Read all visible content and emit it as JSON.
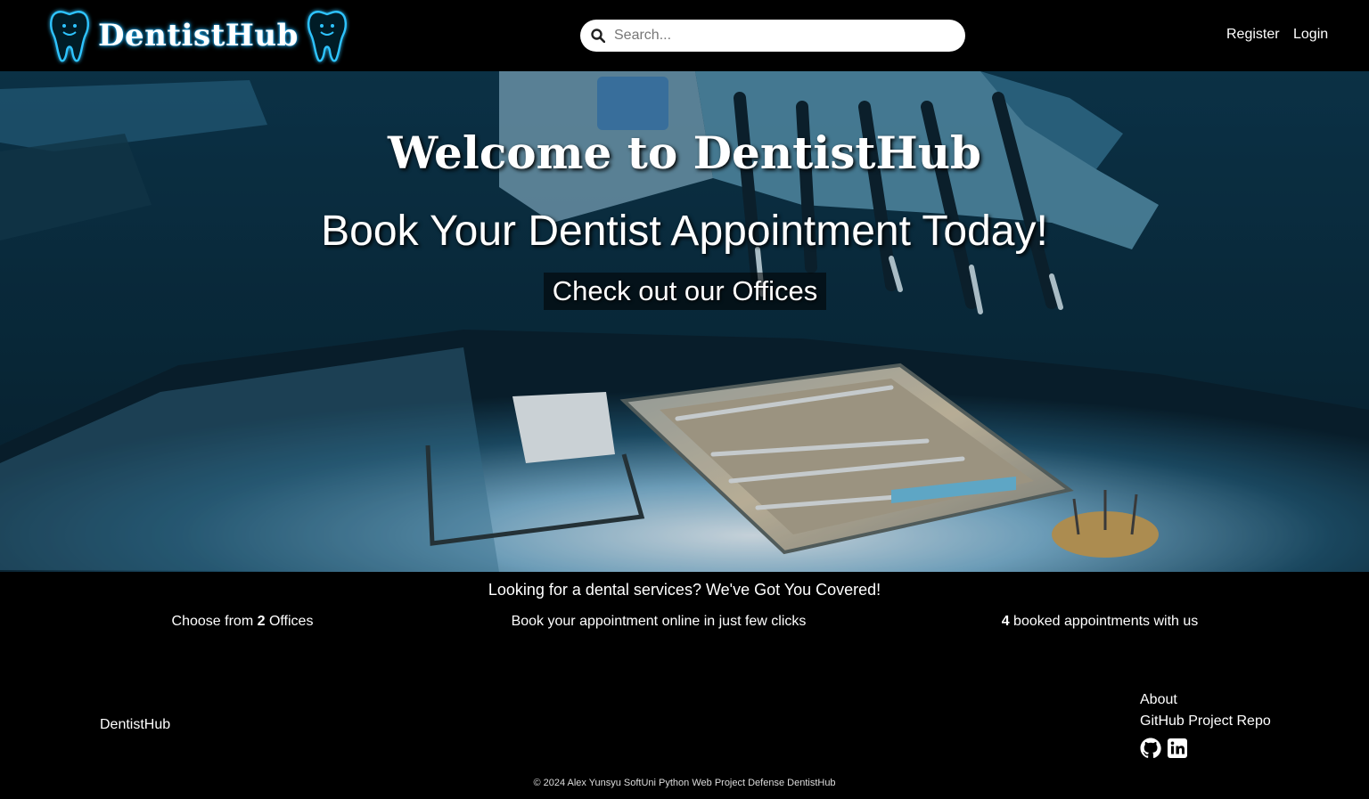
{
  "header": {
    "brand": "DentistHub",
    "search_placeholder": "Search...",
    "nav": {
      "register": "Register",
      "login": "Login"
    },
    "icons": [
      "tooth-icon",
      "search-icon"
    ]
  },
  "hero": {
    "title": "Welcome to DentistHub",
    "subtitle": "Book Your Dentist Appointment Today!",
    "cta": "Check out our Offices"
  },
  "info": {
    "heading": "Looking for a dental services? We've Got You Covered!",
    "offices_prefix": "Choose from",
    "offices_count": "2",
    "offices_suffix": "Offices",
    "booking_text": "Book your appointment online in just few clicks",
    "appointments_count": "4",
    "appointments_suffix": "booked appointments with us"
  },
  "footer": {
    "brand": "DentistHub",
    "links": {
      "about": "About",
      "repo": "GitHub Project Repo"
    },
    "social_icons": [
      "github-icon",
      "linkedin-icon"
    ],
    "copyright": "© 2024 Alex Yunsyu SoftUni Python Web Project Defense DentistHub"
  },
  "colors": {
    "background": "#000000",
    "accent_glow": "#1fb6ff",
    "text": "#ffffff"
  }
}
